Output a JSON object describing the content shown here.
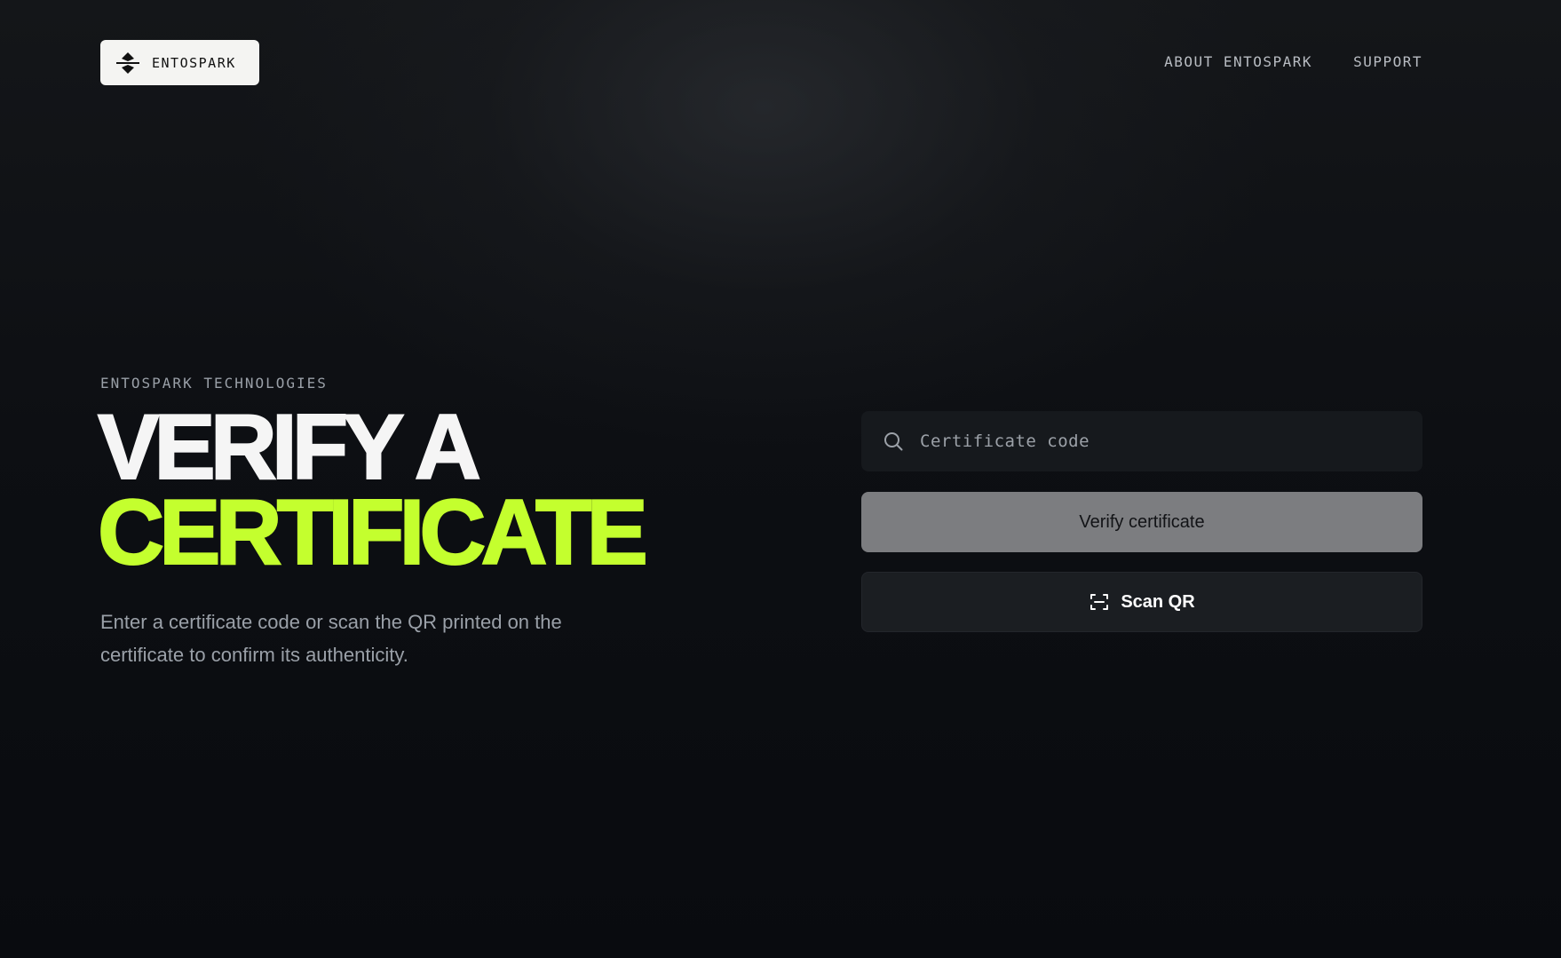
{
  "header": {
    "brand": {
      "name": "ENTOSPARK",
      "icon": "entospark-logo-mark"
    },
    "nav": [
      {
        "label": "ABOUT ENTOSPARK"
      },
      {
        "label": "SUPPORT"
      }
    ]
  },
  "hero": {
    "eyebrow": "ENTOSPARK TECHNOLOGIES",
    "headline_line1": "VERIFY A",
    "headline_line2": "CERTIFICATE",
    "subcopy": "Enter a certificate code or scan the QR printed on the certificate to confirm its authenticity."
  },
  "form": {
    "search": {
      "icon": "search-icon",
      "placeholder": "Certificate code",
      "value": ""
    },
    "verify_label": "Verify certificate",
    "scan_label": "Scan QR",
    "scan_icon": "qr-scan-icon"
  },
  "colors": {
    "accent": "#c4ff2e",
    "background": "#0a0c10",
    "verify_button_bg": "#7c7d80",
    "scan_button_bg": "#1b1e22",
    "input_bg": "#16191d"
  }
}
